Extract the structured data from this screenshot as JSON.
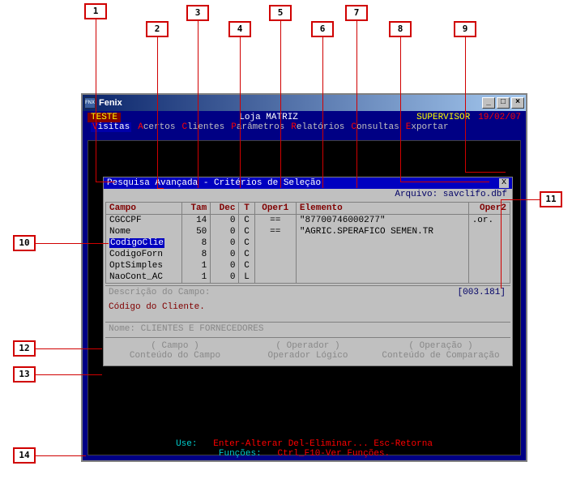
{
  "annotations": [
    "1",
    "2",
    "3",
    "4",
    "5",
    "6",
    "7",
    "8",
    "9",
    "10",
    "11",
    "12",
    "13",
    "14"
  ],
  "window": {
    "title": "Fenix",
    "teste": "TESTE",
    "center": "Loja MATRIZ",
    "supervisor": "SUPERVISOR",
    "date": "19/02/07"
  },
  "menu": {
    "items": [
      {
        "hot": "V",
        "rest": "isitas",
        "selected": true
      },
      {
        "hot": "A",
        "rest": "certos"
      },
      {
        "hot": "C",
        "rest": "lientes"
      },
      {
        "hot": "P",
        "rest": "arâmetros"
      },
      {
        "hot": "R",
        "rest": "elatórios"
      },
      {
        "hot": "C",
        "rest": "onsultas"
      },
      {
        "hot": "E",
        "rest": "xportar"
      }
    ]
  },
  "inner": {
    "title": "Pesquisa Avançada - Critérios de Seleção",
    "arquivo_label": "Arquivo:",
    "arquivo_value": "savclifo.dbf",
    "cols": {
      "campo": "Campo",
      "tam": "Tam",
      "dec": "Dec",
      "t": "T",
      "oper1": "Oper1",
      "elemento": "Elemento",
      "oper2": "Oper2"
    },
    "rows": [
      {
        "campo": "CGCCPF",
        "tam": "14",
        "dec": "0",
        "t": "C",
        "oper1": "==",
        "elemento": "\"87700746000277\"",
        "oper2": ".or."
      },
      {
        "campo": "Nome",
        "tam": "50",
        "dec": "0",
        "t": "C",
        "oper1": "==",
        "elemento": "\"AGRIC.SPERAFICO SEMEN.TR",
        "oper2": ""
      },
      {
        "campo": "CodigoClie",
        "tam": "8",
        "dec": "0",
        "t": "C",
        "oper1": "",
        "elemento": "",
        "oper2": "",
        "selected": true
      },
      {
        "campo": "CodigoForn",
        "tam": "8",
        "dec": "0",
        "t": "C",
        "oper1": "",
        "elemento": "",
        "oper2": ""
      },
      {
        "campo": "OptSimples",
        "tam": "1",
        "dec": "0",
        "t": "C",
        "oper1": "",
        "elemento": "",
        "oper2": ""
      },
      {
        "campo": "NaoCont_AC",
        "tam": "1",
        "dec": "0",
        "t": "L",
        "oper1": "",
        "elemento": "",
        "oper2": ""
      }
    ],
    "desc_label": "Descrição do Campo:",
    "desc_value": "Código do Cliente.",
    "index": "[003.181]",
    "nome_label": "Nome:",
    "nome_value": "CLIENTES E FORNECEDORES",
    "footer": [
      {
        "h": "( Campo )",
        "s": "Conteúdo do Campo"
      },
      {
        "h": "( Operador )",
        "s": "Operador Lógico"
      },
      {
        "h": "( Operação )",
        "s": "Conteúdo de Comparação"
      }
    ]
  },
  "status": {
    "line1_label": "Use:",
    "line1": "Enter-Alterar Del-Eliminar... Esc-Retorna",
    "line2_label": "Funções:",
    "line2": "Ctrl_F10-Ver Funções."
  }
}
